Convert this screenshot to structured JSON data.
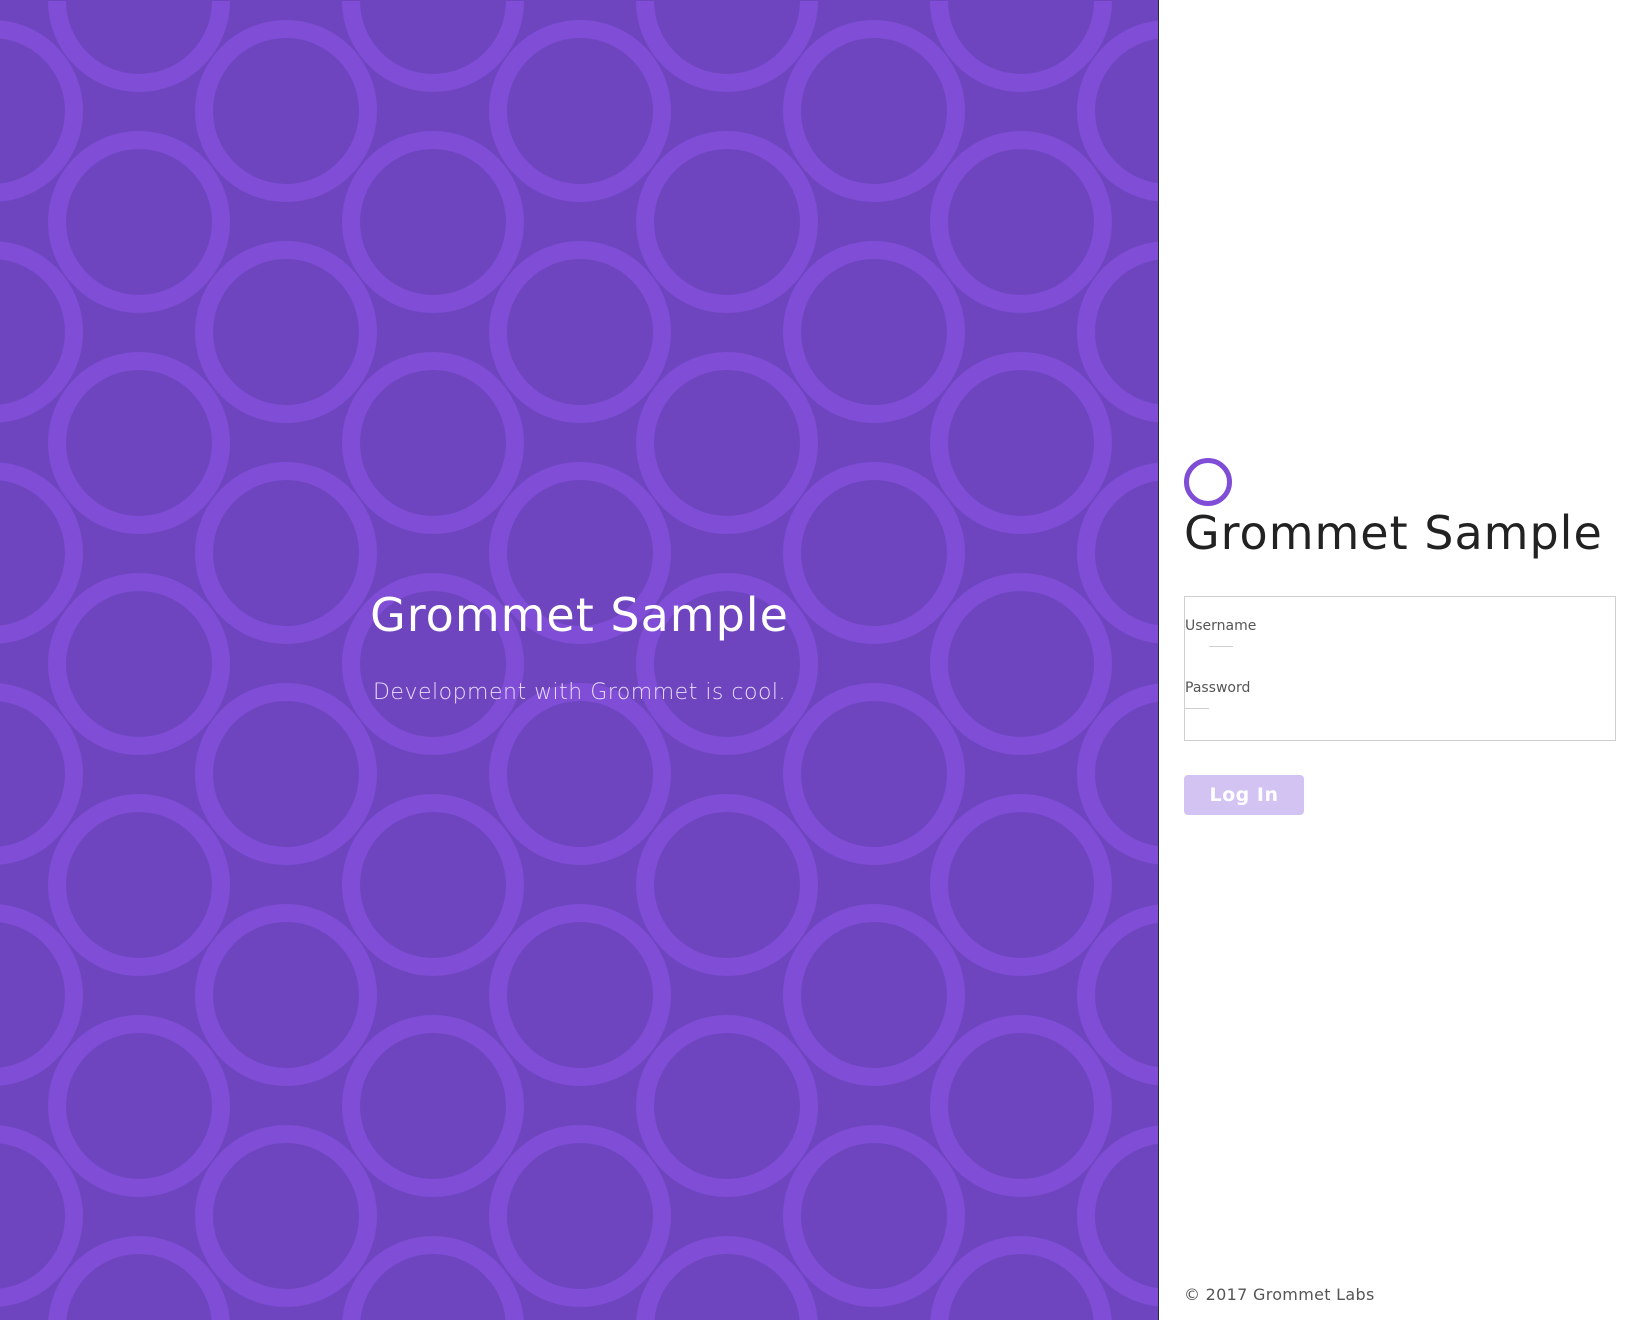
{
  "hero": {
    "title": "Grommet Sample",
    "subtitle": "Development with Grommet is cool."
  },
  "login": {
    "logo_icon": "grommet-ring-icon",
    "title": "Grommet Sample",
    "fields": [
      {
        "label": "Username",
        "value": "",
        "placeholder": ""
      },
      {
        "label": "Password",
        "value": "",
        "placeholder": ""
      }
    ],
    "submit_label": "Log In"
  },
  "footer": {
    "copyright": "© 2017 Grommet Labs"
  },
  "colors": {
    "brand": "#6e45bf",
    "pattern_ring": "#7f4dd6",
    "logo_ring": "#7f4dd6",
    "button_disabled": "#d3c3f2"
  }
}
